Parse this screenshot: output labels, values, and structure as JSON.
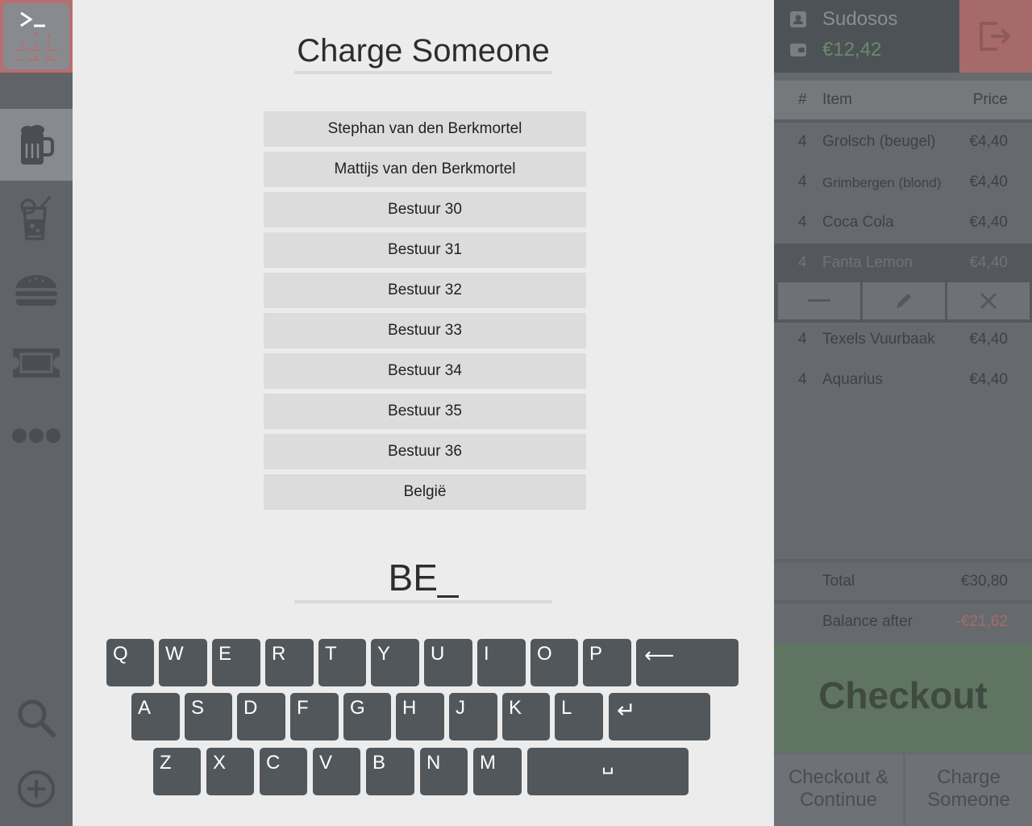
{
  "sidebar": {
    "icons": [
      "terminal-icon",
      "beer-icon",
      "drink-icon",
      "burger-icon",
      "ticket-icon",
      "more-icon",
      "search-icon",
      "add-icon"
    ]
  },
  "modal": {
    "title": "Charge Someone",
    "people": [
      "Stephan van den Berkmortel",
      "Mattijs van den Berkmortel",
      "Bestuur 30",
      "Bestuur 31",
      "Bestuur 32",
      "Bestuur 33",
      "Bestuur 34",
      "Bestuur 35",
      "Bestuur 36",
      "België"
    ],
    "search_value": "BE_"
  },
  "keyboard": {
    "row1": [
      "Q",
      "W",
      "E",
      "R",
      "T",
      "Y",
      "U",
      "I",
      "O",
      "P"
    ],
    "row2": [
      "A",
      "S",
      "D",
      "F",
      "G",
      "H",
      "J",
      "K",
      "L"
    ],
    "row3": [
      "Z",
      "X",
      "C",
      "V",
      "B",
      "N",
      "M"
    ],
    "backspace": "⟵",
    "enter": "↵",
    "space": "␣"
  },
  "account": {
    "name": "Sudosos",
    "balance": "€12,42"
  },
  "order": {
    "headers": {
      "qty": "#",
      "item": "Item",
      "price": "Price"
    },
    "rows": [
      {
        "qty": "4",
        "item": "Grolsch (beugel)",
        "price": "€4,40"
      },
      {
        "qty": "4",
        "item": "Grimbergen (blond)",
        "price": "€4,40"
      },
      {
        "qty": "4",
        "item": "Coca Cola",
        "price": "€4,40"
      },
      {
        "qty": "4",
        "item": "Fanta Lemon",
        "price": "€4,40"
      },
      {
        "qty": "4",
        "item": "Texels Vuurbaak",
        "price": "€4,40"
      },
      {
        "qty": "4",
        "item": "Aquarius",
        "price": "€4,40"
      }
    ],
    "total_label": "Total",
    "total_value": "€30,80",
    "balance_after_label": "Balance after",
    "balance_after_value": "-€21,62"
  },
  "actions": {
    "checkout": "Checkout",
    "checkout_continue": "Checkout &\nContinue",
    "charge_someone": "Charge\nSomeone"
  },
  "colors": {
    "negative": "#a86a6a",
    "positive": "#6b8a6b",
    "checkout_bg": "#5f7461"
  }
}
